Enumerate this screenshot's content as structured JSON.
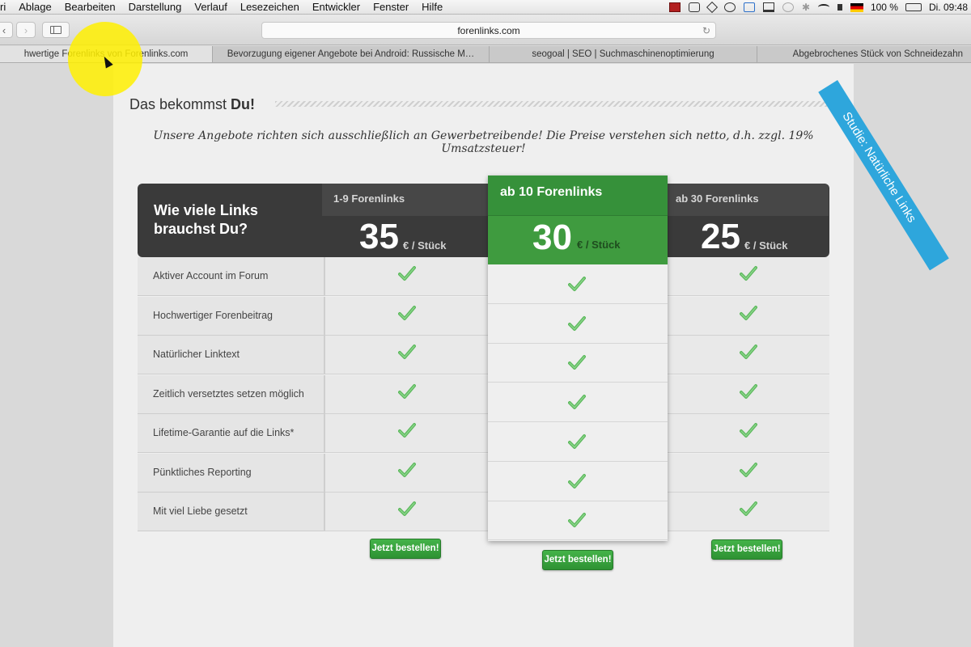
{
  "menubar": {
    "items": [
      "ri",
      "Ablage",
      "Bearbeiten",
      "Darstellung",
      "Verlauf",
      "Lesezeichen",
      "Entwickler",
      "Fenster",
      "Hilfe"
    ],
    "battery": "100 %",
    "clock": "Di. 09:48"
  },
  "toolbar": {
    "address": "forenlinks.com"
  },
  "tabs": [
    "hwertige Forenlinks von Forenlinks.com",
    "Bevorzugung eigener Angebote bei Android: Russische M…",
    "seogoal | SEO | Suchmaschinenoptimierung",
    "Abgebrochenes Stück von Schneidezahn"
  ],
  "page": {
    "title_prefix": "Das bekommst ",
    "title_bold": "Du!",
    "notice": "Unsere Angebote richten sich ausschließlich an Gewerbetreibende! Die Preise verstehen sich netto, d.h. zzgl. 19% Umsatzsteuer!",
    "ribbon": "Studie: Natürliche Links"
  },
  "pricing": {
    "question": "Wie viele Links brauchst Du?",
    "unit": "€ / Stück",
    "plans": [
      {
        "title": "1-9 Forenlinks",
        "price": "35",
        "button": "Jetzt bestellen!"
      },
      {
        "title": "ab 10 Forenlinks",
        "price": "30",
        "button": "Jetzt bestellen!",
        "highlighted": true
      },
      {
        "title": "ab 30 Forenlinks",
        "price": "25",
        "button": "Jetzt bestellen!"
      }
    ],
    "features": [
      "Aktiver Account im Forum",
      "Hochwertiger Forenbeitrag",
      "Natürlicher Linktext",
      "Zeitlich versetztes setzen möglich",
      "Lifetime-Garantie auf die Links*",
      "Pünktliches Reporting",
      "Mit viel Liebe gesetzt"
    ],
    "colors": {
      "accent": "#3f9b3f",
      "header": "#3a3a3a",
      "ribbon": "#2ea6dc"
    }
  }
}
